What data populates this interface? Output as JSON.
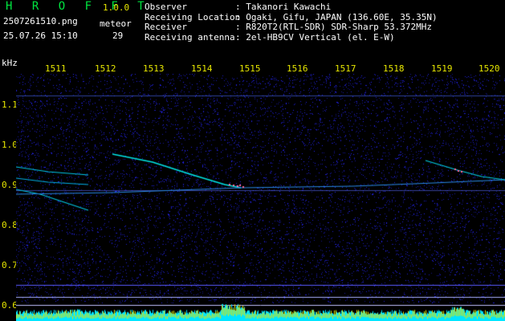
{
  "header": {
    "app_title": "H R O F F T",
    "version": "1.0.0",
    "filename": "2507261510.png",
    "timestamp": "25.07.26 15:10",
    "meteor_label": "meteor",
    "meteor_count": "29",
    "info": [
      {
        "key": "Observer",
        "value": ": Takanori Kawachi"
      },
      {
        "key": "Receiving Location",
        "value": ": Ogaki, Gifu, JAPAN (136.60E, 35.35N)"
      },
      {
        "key": "Receiver",
        "value": ": R820T2(RTL-SDR) SDR-Sharp 53.372MHz"
      },
      {
        "key": "Receiving antenna",
        "value": ": 2el-HB9CV Vertical (el. E-W)"
      }
    ]
  },
  "axis": {
    "unit": "kHz",
    "time_ticks": [
      "1511",
      "1512",
      "1513",
      "1514",
      "1515",
      "1516",
      "1517",
      "1518",
      "1519",
      "1520"
    ],
    "freq_ticks": [
      "1.1",
      "1.0",
      "0.9",
      "0.8",
      "0.7",
      "0.6"
    ]
  },
  "colors": {
    "background": "#000000",
    "noise": "#1a1aff",
    "trace": "#00e6e6",
    "title": "#00e640",
    "tick": "#e6e600",
    "amplitude_bars": "#00e6ff"
  }
}
